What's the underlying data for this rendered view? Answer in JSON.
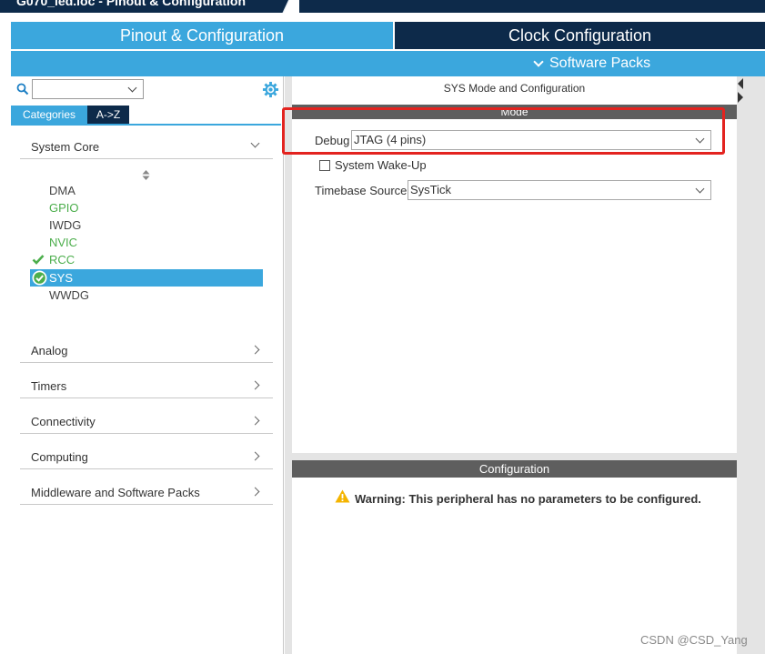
{
  "window": {
    "title": "G070_led.ioc - Pinout & Configuration"
  },
  "tabs": {
    "pinout": "Pinout & Configuration",
    "clock": "Clock Configuration"
  },
  "software_packs": {
    "label": "Software Packs"
  },
  "sidebar": {
    "search": {
      "value": ""
    },
    "view_tabs": {
      "categories": "Categories",
      "az": "A->Z"
    },
    "categories": [
      {
        "label": "System Core",
        "expanded": true
      },
      {
        "label": "Analog"
      },
      {
        "label": "Timers"
      },
      {
        "label": "Connectivity"
      },
      {
        "label": "Computing"
      },
      {
        "label": "Middleware and Software Packs"
      }
    ],
    "peripherals": [
      {
        "label": "DMA",
        "state": "default"
      },
      {
        "label": "GPIO",
        "state": "configured"
      },
      {
        "label": "IWDG",
        "state": "default"
      },
      {
        "label": "NVIC",
        "state": "configured"
      },
      {
        "label": "RCC",
        "state": "configured-checked"
      },
      {
        "label": "SYS",
        "state": "selected-checked"
      },
      {
        "label": "WWDG",
        "state": "default"
      }
    ]
  },
  "mode_panel": {
    "title": "SYS Mode and Configuration",
    "header": "Mode",
    "debug": {
      "label": "Debug",
      "value": "JTAG (4 pins)"
    },
    "wakeup": {
      "label": "System Wake-Up",
      "checked": false
    },
    "timebase": {
      "label": "Timebase Source",
      "value": "SysTick"
    }
  },
  "config_panel": {
    "header": "Configuration",
    "warning": "Warning: This peripheral has no parameters to be configured."
  },
  "watermark": "CSDN @CSD_Yang",
  "colors": {
    "accent": "#3ba7dd",
    "navy": "#0d2a4a",
    "green": "#4cae4c",
    "highlight": "#e3231f",
    "header_gray": "#5e5e5e"
  }
}
